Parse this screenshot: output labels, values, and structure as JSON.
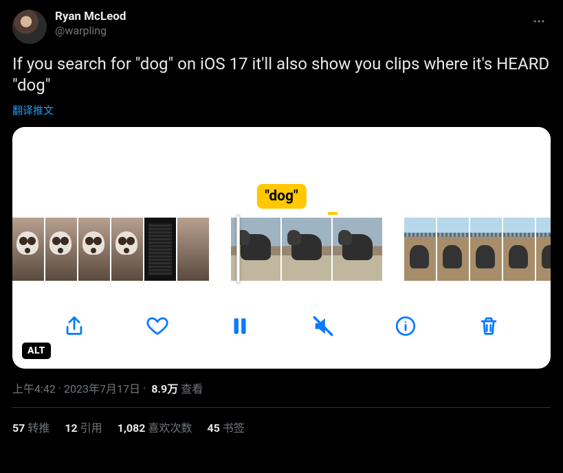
{
  "user": {
    "display_name": "Ryan McLeod",
    "handle": "@warpling"
  },
  "body_text": "If you search for \"dog\" on iOS 17 it'll also show you clips where it's HEARD \"dog\"",
  "translate_label": "翻译推文",
  "media": {
    "caption_label": "\"dog\"",
    "alt_badge": "ALT",
    "toolbar_icons": {
      "share": "share-icon",
      "like": "heart-icon",
      "pause": "pause-icon",
      "mute": "mute-icon",
      "info": "info-icon",
      "delete": "trash-icon"
    }
  },
  "meta": {
    "time": "上午4:42",
    "date": "2023年7月17日",
    "sep": " · ",
    "views_number": "8.9万",
    "views_label": " 查看"
  },
  "stats": {
    "retweets": {
      "num": "57",
      "label": "转推"
    },
    "quotes": {
      "num": "12",
      "label": "引用"
    },
    "likes": {
      "num": "1,082",
      "label": "喜欢次数"
    },
    "bookmarks": {
      "num": "45",
      "label": "书签"
    }
  }
}
